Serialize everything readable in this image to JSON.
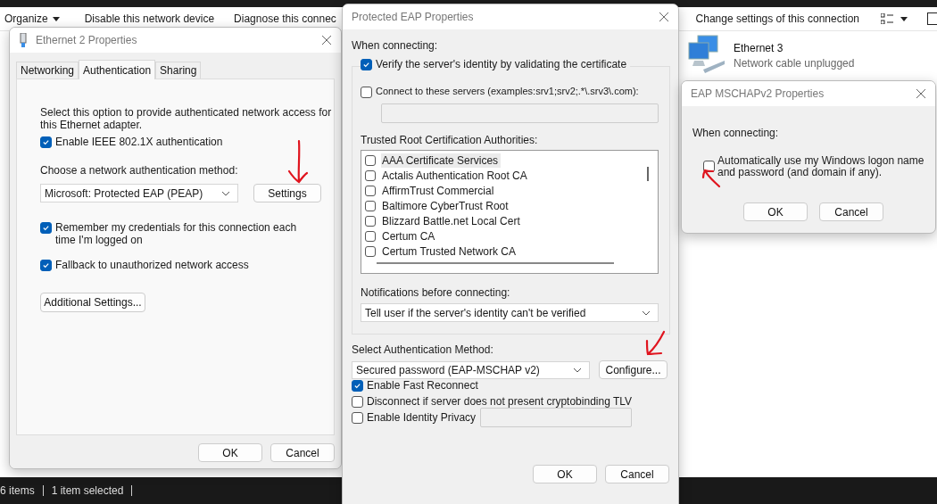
{
  "explorer": {
    "toolbar": [
      {
        "label": "Organize",
        "kind": "menu"
      },
      {
        "label": "Disable this network device",
        "kind": "command"
      },
      {
        "label": "Diagnose this connec",
        "kind": "command"
      },
      {
        "label": "Change settings of this connection",
        "kind": "command"
      }
    ],
    "items": [
      {
        "name": "Ethernet 3",
        "status": "Network cable unplugged"
      }
    ],
    "status_bar": [
      "6 items",
      "1 item selected"
    ]
  },
  "ethernet_dialog": {
    "title": "Ethernet 2 Properties",
    "tabs": [
      {
        "label": "Networking",
        "selected": false
      },
      {
        "label": "Authentication",
        "selected": true
      },
      {
        "label": "Sharing",
        "selected": false
      }
    ],
    "description": "Select this option to provide authenticated network access for this Ethernet adapter.",
    "enable": {
      "label": "Enable IEEE 802.1X authentication",
      "checked": true
    },
    "method_label": "Choose a network authentication method:",
    "method_value": "Microsoft: Protected EAP (PEAP)",
    "settings_button": "Settings",
    "options": [
      {
        "label": "Remember my credentials for this connection each time I'm logged on",
        "checked": true
      },
      {
        "label": "Fallback to unauthorized network access",
        "checked": true
      }
    ],
    "additional_button": "Additional Settings...",
    "buttons": [
      "OK",
      "Cancel"
    ]
  },
  "peap_dialog": {
    "title": "Protected EAP Properties",
    "when_connecting": "When connecting:",
    "verify": {
      "label": "Verify the server's identity by validating the certificate",
      "checked": true
    },
    "connect_servers": {
      "label": "Connect to these servers (examples:srv1;srv2;.*\\.srv3\\.com):",
      "checked": false
    },
    "trusted_label": "Trusted Root Certification Authorities:",
    "authorities": [
      {
        "name": "AAA Certificate Services",
        "checked": false,
        "selected": true
      },
      {
        "name": "Actalis Authentication Root CA",
        "checked": false,
        "selected": false
      },
      {
        "name": "AffirmTrust Commercial",
        "checked": false,
        "selected": false
      },
      {
        "name": "Baltimore CyberTrust Root",
        "checked": false,
        "selected": false
      },
      {
        "name": "Blizzard Battle.net Local Cert",
        "checked": false,
        "selected": false
      },
      {
        "name": "Certum CA",
        "checked": false,
        "selected": false
      },
      {
        "name": "Certum Trusted Network CA",
        "checked": false,
        "selected": false
      }
    ],
    "notifications_label": "Notifications before connecting:",
    "notifications_value": "Tell user if the server's identity can't be verified",
    "method_label": "Select Authentication Method:",
    "method_value": "Secured password (EAP-MSCHAP v2)",
    "configure_button": "Configure...",
    "options": [
      {
        "label": "Enable Fast Reconnect",
        "checked": true
      },
      {
        "label": "Disconnect if server does not present cryptobinding TLV",
        "checked": false
      },
      {
        "label": "Enable Identity Privacy",
        "checked": false
      }
    ],
    "buttons": [
      "OK",
      "Cancel"
    ]
  },
  "mschap_dialog": {
    "title": "EAP MSCHAPv2 Properties",
    "when_connecting": "When connecting:",
    "auto_logon": {
      "label": "Automatically use my Windows logon name and password (and domain if any).",
      "checked": false
    },
    "buttons": [
      "OK",
      "Cancel"
    ]
  }
}
